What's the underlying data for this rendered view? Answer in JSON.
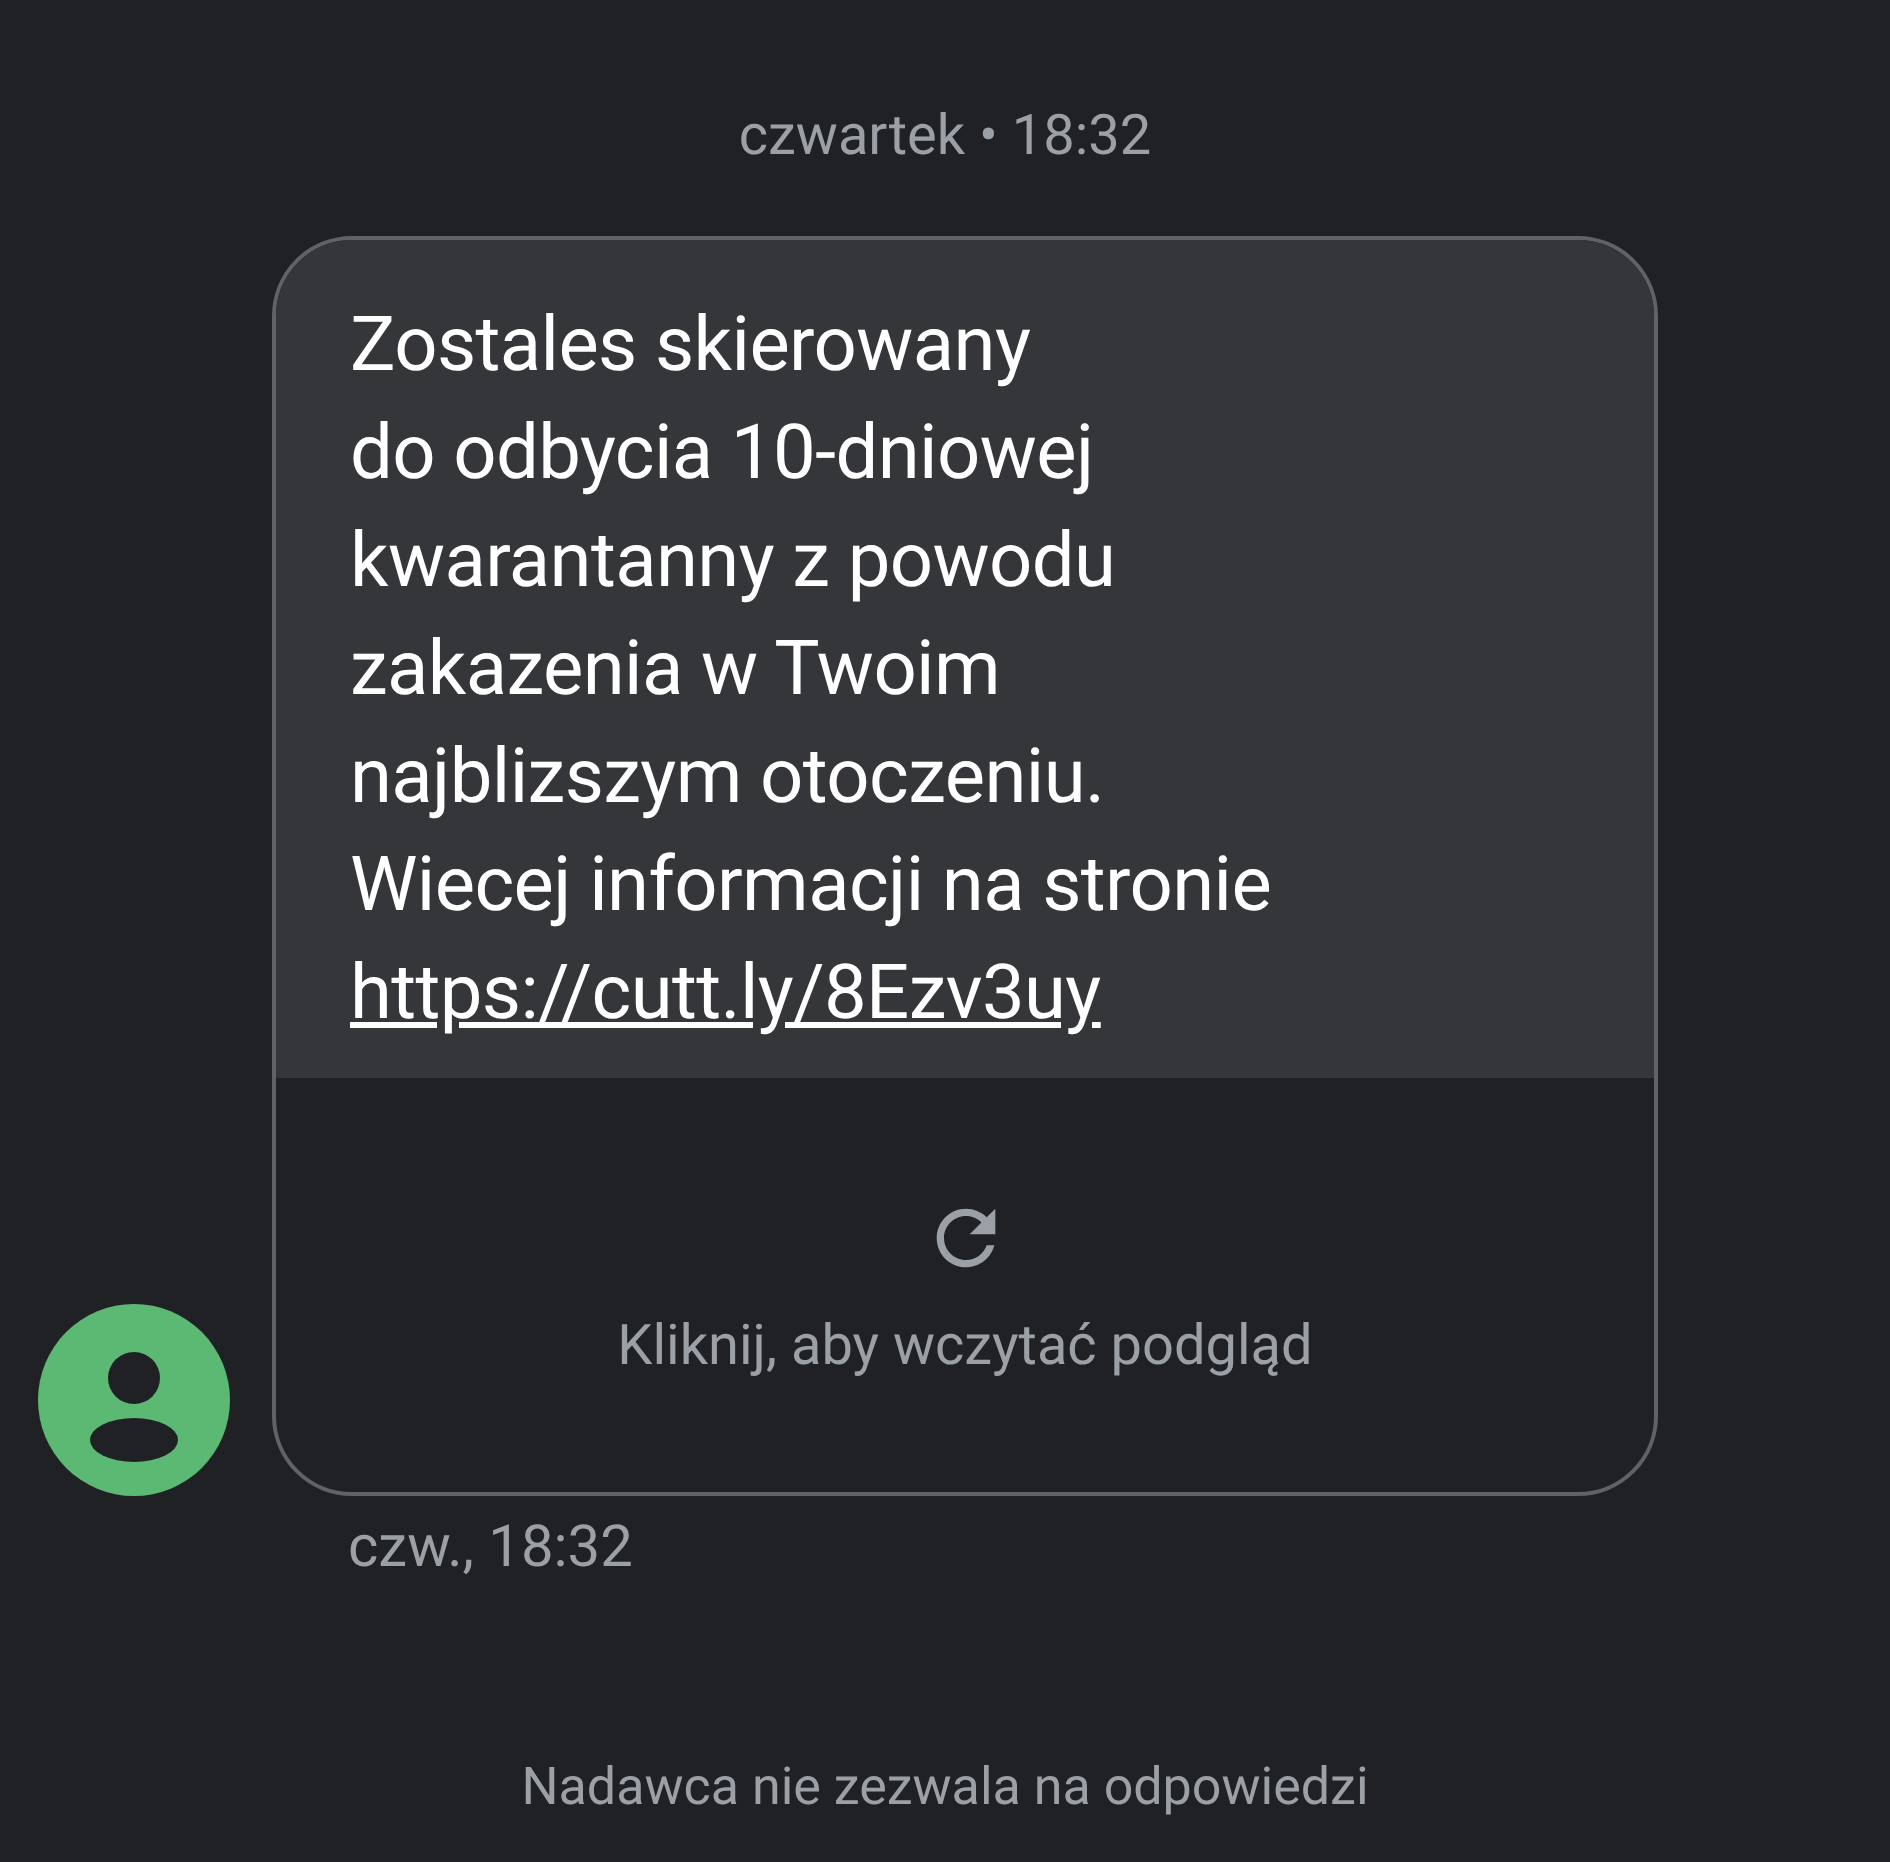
{
  "date_header": "czwartek • 18:32",
  "message": {
    "lines": [
      "Zostales skierowany",
      "do odbycia 10-dniowej",
      "kwarantanny z powodu",
      "zakazenia w Twoim",
      "najblizszym otoczeniu.",
      "Wiecej informacji na stronie"
    ],
    "link": "https://cutt.ly/8Ezv3uy"
  },
  "preview": {
    "label": "Kliknij, aby wczytać podgląd"
  },
  "timestamp": "czw., 18:32",
  "footer": "Nadawca nie zezwala na odpowiedzi"
}
